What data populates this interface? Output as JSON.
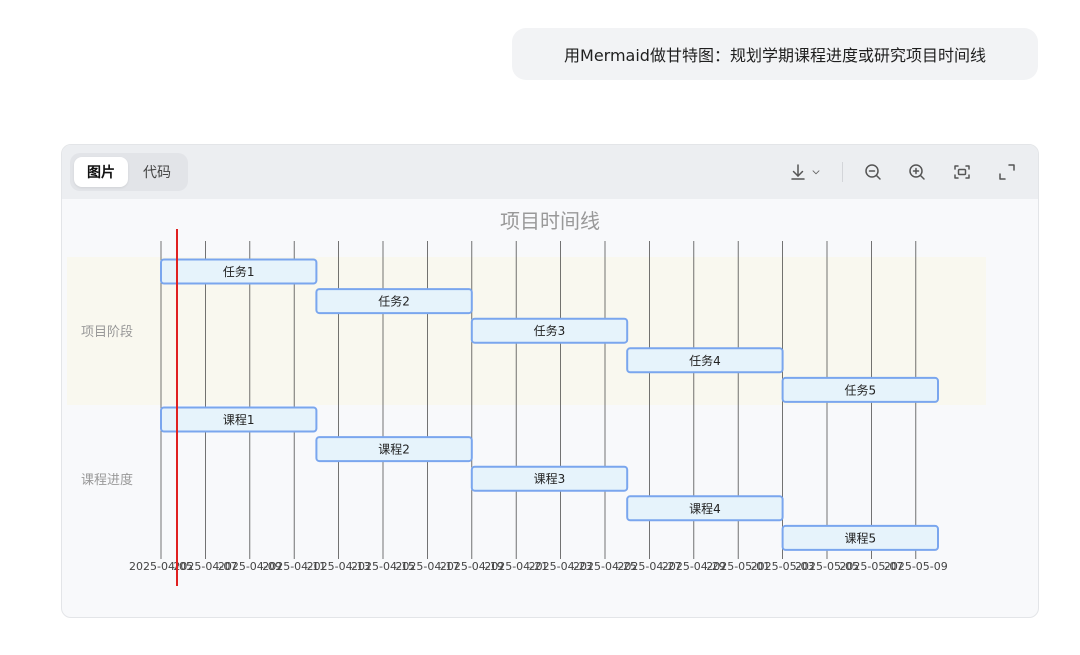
{
  "user_message": "用Mermaid做甘特图：规划学期课程进度或研究项目时间线",
  "viewer": {
    "tabs": [
      {
        "label": "图片",
        "active": true
      },
      {
        "label": "代码",
        "active": false
      }
    ],
    "tools": [
      "download-icon",
      "chevron-down-icon",
      "zoom-out-icon",
      "zoom-in-icon",
      "fit-screen-icon",
      "fullscreen-icon"
    ]
  },
  "chart_data": {
    "type": "gantt",
    "title": "项目时间线",
    "sections": [
      {
        "name": "项目阶段",
        "tasks": [
          {
            "name": "任务1",
            "start": "2025-04-05",
            "end": "2025-04-12"
          },
          {
            "name": "任务2",
            "start": "2025-04-12",
            "end": "2025-04-19"
          },
          {
            "name": "任务3",
            "start": "2025-04-19",
            "end": "2025-04-26"
          },
          {
            "name": "任务4",
            "start": "2025-04-26",
            "end": "2025-05-03"
          },
          {
            "name": "任务5",
            "start": "2025-05-03",
            "end": "2025-05-10"
          }
        ]
      },
      {
        "name": "课程进度",
        "tasks": [
          {
            "name": "课程1",
            "start": "2025-04-05",
            "end": "2025-04-12"
          },
          {
            "name": "课程2",
            "start": "2025-04-12",
            "end": "2025-04-19"
          },
          {
            "name": "课程3",
            "start": "2025-04-19",
            "end": "2025-04-26"
          },
          {
            "name": "课程4",
            "start": "2025-04-26",
            "end": "2025-05-03"
          },
          {
            "name": "课程5",
            "start": "2025-05-03",
            "end": "2025-05-10"
          }
        ]
      }
    ],
    "x_ticks": [
      "2025-04-05",
      "2025-04-07",
      "2025-04-09",
      "2025-04-11",
      "2025-04-13",
      "2025-04-15",
      "2025-04-17",
      "2025-04-19",
      "2025-04-21",
      "2025-04-23",
      "2025-04-25",
      "2025-04-27",
      "2025-04-29",
      "2025-05-01",
      "2025-05-03",
      "2025-05-05",
      "2025-05-07",
      "2025-05-09"
    ],
    "today_marker": "2025-04-05",
    "colors": {
      "section_bg_1": "#f9f8ef",
      "section_bg_2": "#f8f9fb",
      "task_fill": "#e6f3fb",
      "task_stroke": "#7aa6ee",
      "today_line": "#e02020",
      "grid": "#333333",
      "title": "#999999",
      "section_label": "#999999"
    }
  }
}
